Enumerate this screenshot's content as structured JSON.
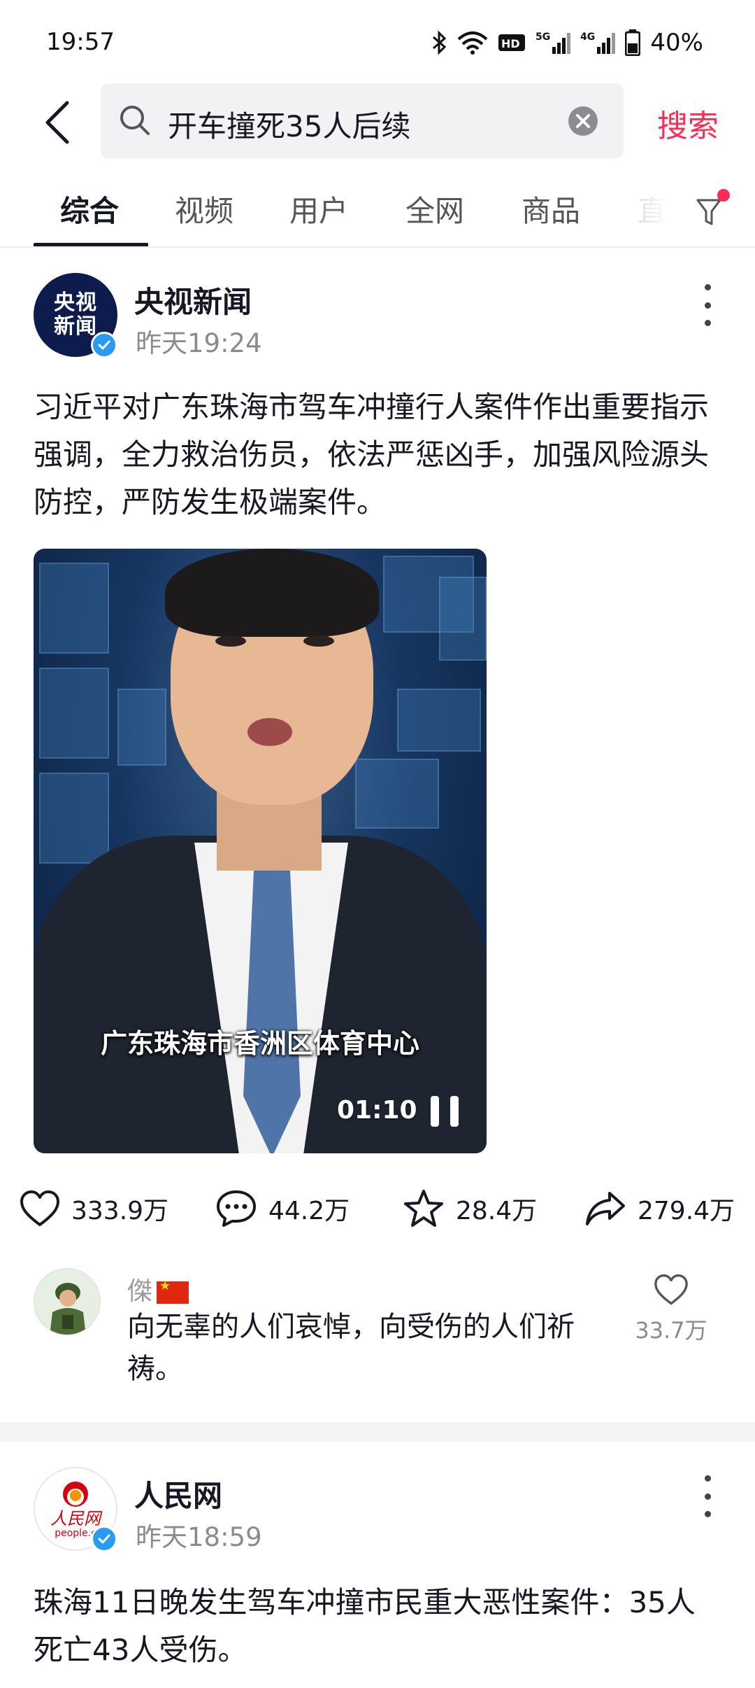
{
  "status_bar": {
    "time": "19:57",
    "battery": "40%",
    "icons": [
      "bluetooth-icon",
      "wifi-icon",
      "hd-icon",
      "5g-signal-icon",
      "4g-signal-icon",
      "battery-icon"
    ]
  },
  "search": {
    "query": "开车撞死35人后续",
    "button_label": "搜索"
  },
  "tabs": [
    {
      "label": "综合",
      "active": true
    },
    {
      "label": "视频"
    },
    {
      "label": "用户"
    },
    {
      "label": "全网"
    },
    {
      "label": "商品"
    },
    {
      "label": "直"
    }
  ],
  "posts": [
    {
      "author": "央视新闻",
      "avatar_lines": [
        "央视",
        "新闻"
      ],
      "time": "昨天19:24",
      "text": "习近平对广东珠海市驾车冲撞行人案件作出重要指示强调，全力救治伤员，依法严惩凶手，加强风险源头防控，严防发生极端案件。",
      "video": {
        "caption": "广东珠海市香洲区体育中心",
        "duration": "01:10"
      },
      "stats": {
        "likes": "333.9万",
        "comments": "44.2万",
        "favorites": "28.4万",
        "shares": "279.4万"
      },
      "top_comment": {
        "user": "傑",
        "text": "向无辜的人们哀悼，向受伤的人们祈祷。",
        "likes": "33.7万"
      }
    },
    {
      "author": "人民网",
      "avatar_text": "人民网",
      "avatar_subtext": "people.c",
      "time": "昨天18:59",
      "text": "珠海11日晚发生驾车冲撞市民重大恶性案件：35人死亡43人受伤。"
    }
  ],
  "colors": {
    "accent": "#fe2c55",
    "text": "#161823",
    "secondary": "#8a8b91",
    "verified": "#2a9bf5"
  }
}
